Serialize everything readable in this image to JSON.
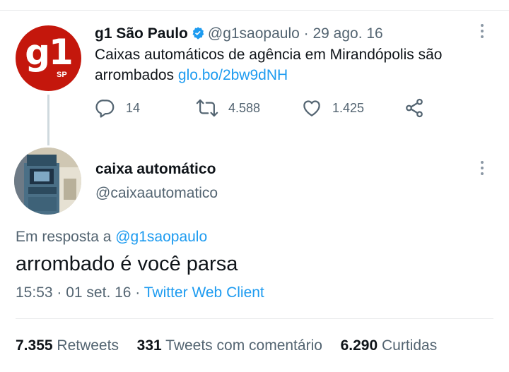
{
  "parent_tweet": {
    "avatar_logo": "g1",
    "avatar_sub": "SP",
    "author_name": "g1 São Paulo",
    "verified": true,
    "handle": "@g1saopaulo",
    "separator": " · ",
    "date": "29 ago. 16",
    "text": "Caixas automáticos de agência em Mirandópolis são arrombados ",
    "link": "glo.bo/2bw9dNH",
    "replies": "14",
    "retweets": "4.588",
    "likes": "1.425",
    "icons": [
      "reply-icon",
      "retweet-icon",
      "like-icon",
      "share-icon",
      "more-icon",
      "verified-icon"
    ]
  },
  "main_tweet": {
    "author_name": "caixa automático",
    "handle": "@caixaautomatico",
    "reply_label": "Em resposta a ",
    "reply_to": "@g1saopaulo",
    "text": "arrombado é você parsa",
    "time": "15:53",
    "separator": " · ",
    "date": "01 set. 16",
    "client": "Twitter Web Client"
  },
  "stats": {
    "retweets_count": "7.355",
    "retweets_label": "Retweets",
    "comments_count": "331",
    "comments_label": "Tweets com comentário",
    "likes_count": "6.290",
    "likes_label": "Curtidas"
  },
  "colors": {
    "accent": "#1d9bf0",
    "g1_red": "#c4170c",
    "muted": "#536471",
    "text": "#0f1419"
  }
}
